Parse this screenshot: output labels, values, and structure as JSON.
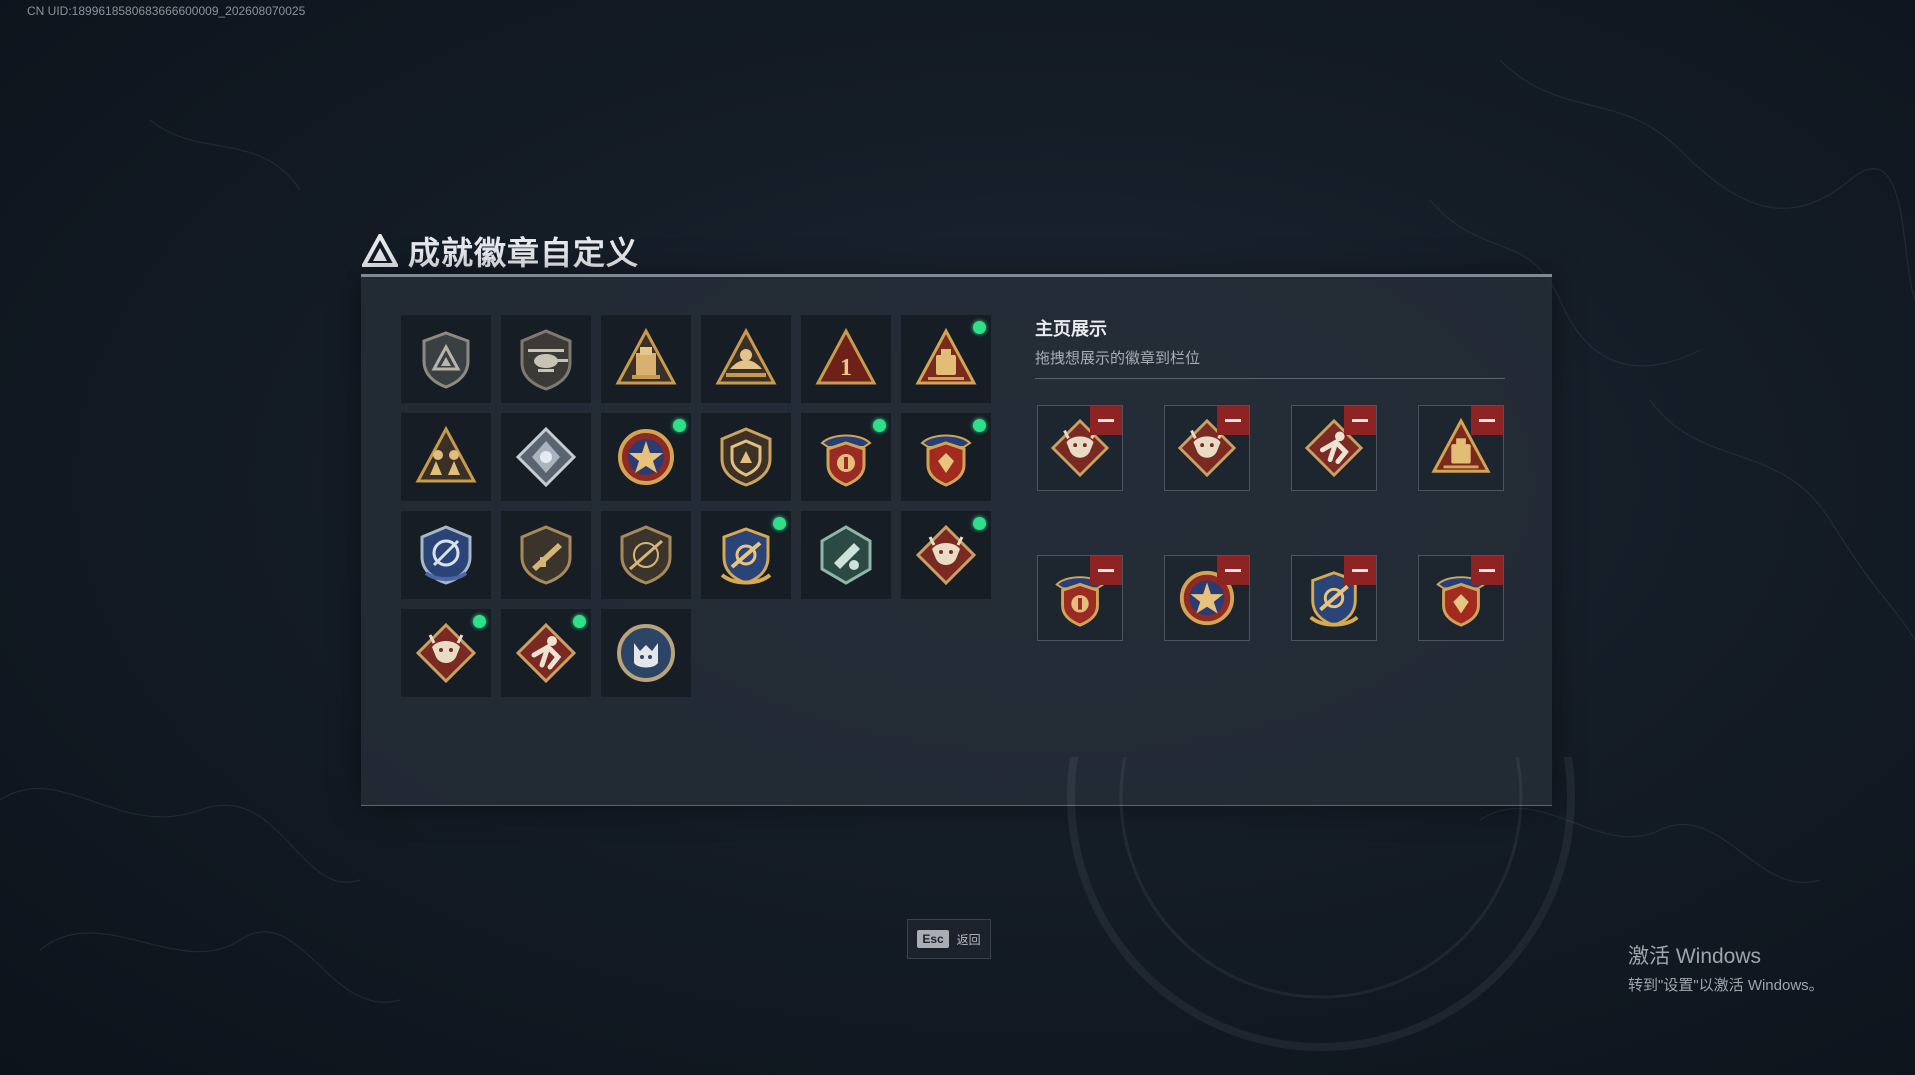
{
  "uid_text": "CN UID:1899618580683666600009_202608070025",
  "panel": {
    "title": "成就徽章自定义",
    "icon": "triangle-logo-icon"
  },
  "badges": [
    {
      "icon": "shield-triangle-icon",
      "new": false
    },
    {
      "icon": "helicopter-icon",
      "new": false
    },
    {
      "icon": "gold-tower-triangle-icon",
      "new": false
    },
    {
      "icon": "gold-bird-triangle-icon",
      "new": false
    },
    {
      "icon": "rank-one-triangle-icon",
      "new": false
    },
    {
      "icon": "gold-bag-red-triangle-icon",
      "new": true
    },
    {
      "icon": "gold-soldiers-triangle-icon",
      "new": false
    },
    {
      "icon": "silver-diamond-icon",
      "new": false
    },
    {
      "icon": "star-medal-icon",
      "new": true
    },
    {
      "icon": "gold-shield-emblem-icon",
      "new": false
    },
    {
      "icon": "winged-shield-medal-icon",
      "new": true
    },
    {
      "icon": "red-shield-medal-icon",
      "new": true
    },
    {
      "icon": "blue-crest-shield-icon",
      "new": false
    },
    {
      "icon": "rifle-shield-icon",
      "new": false
    },
    {
      "icon": "sniper-shield-icon",
      "new": false
    },
    {
      "icon": "gold-laurel-shield-icon",
      "new": true
    },
    {
      "icon": "green-hexagon-icon",
      "new": false
    },
    {
      "icon": "red-dragon-diamond-icon",
      "new": true
    },
    {
      "icon": "red-dragon-diamond-icon",
      "new": true
    },
    {
      "icon": "red-runner-diamond-icon",
      "new": true
    },
    {
      "icon": "wolf-circle-icon",
      "new": false
    }
  ],
  "showcase": {
    "title": "主页展示",
    "subtitle": "拖拽想展示的徽章到栏位",
    "slots": [
      {
        "icon": "red-dragon-diamond-icon"
      },
      {
        "icon": "red-dragon-diamond-icon"
      },
      {
        "icon": "red-runner-diamond-icon"
      },
      {
        "icon": "gold-bag-red-triangle-icon"
      },
      {
        "icon": "winged-shield-medal-icon"
      },
      {
        "icon": "star-medal-icon"
      },
      {
        "icon": "gold-laurel-shield-icon"
      },
      {
        "icon": "red-shield-medal-icon"
      }
    ]
  },
  "esc_button": {
    "key": "Esc",
    "label": "返回"
  },
  "watermark": {
    "title": "激活 Windows",
    "subtitle": "转到\"设置\"以激活 Windows。"
  },
  "colors": {
    "new_indicator": "#2fe08a",
    "remove_button": "#8e2324",
    "panel_bg": "#262e38",
    "gold": "#c89a4e"
  }
}
